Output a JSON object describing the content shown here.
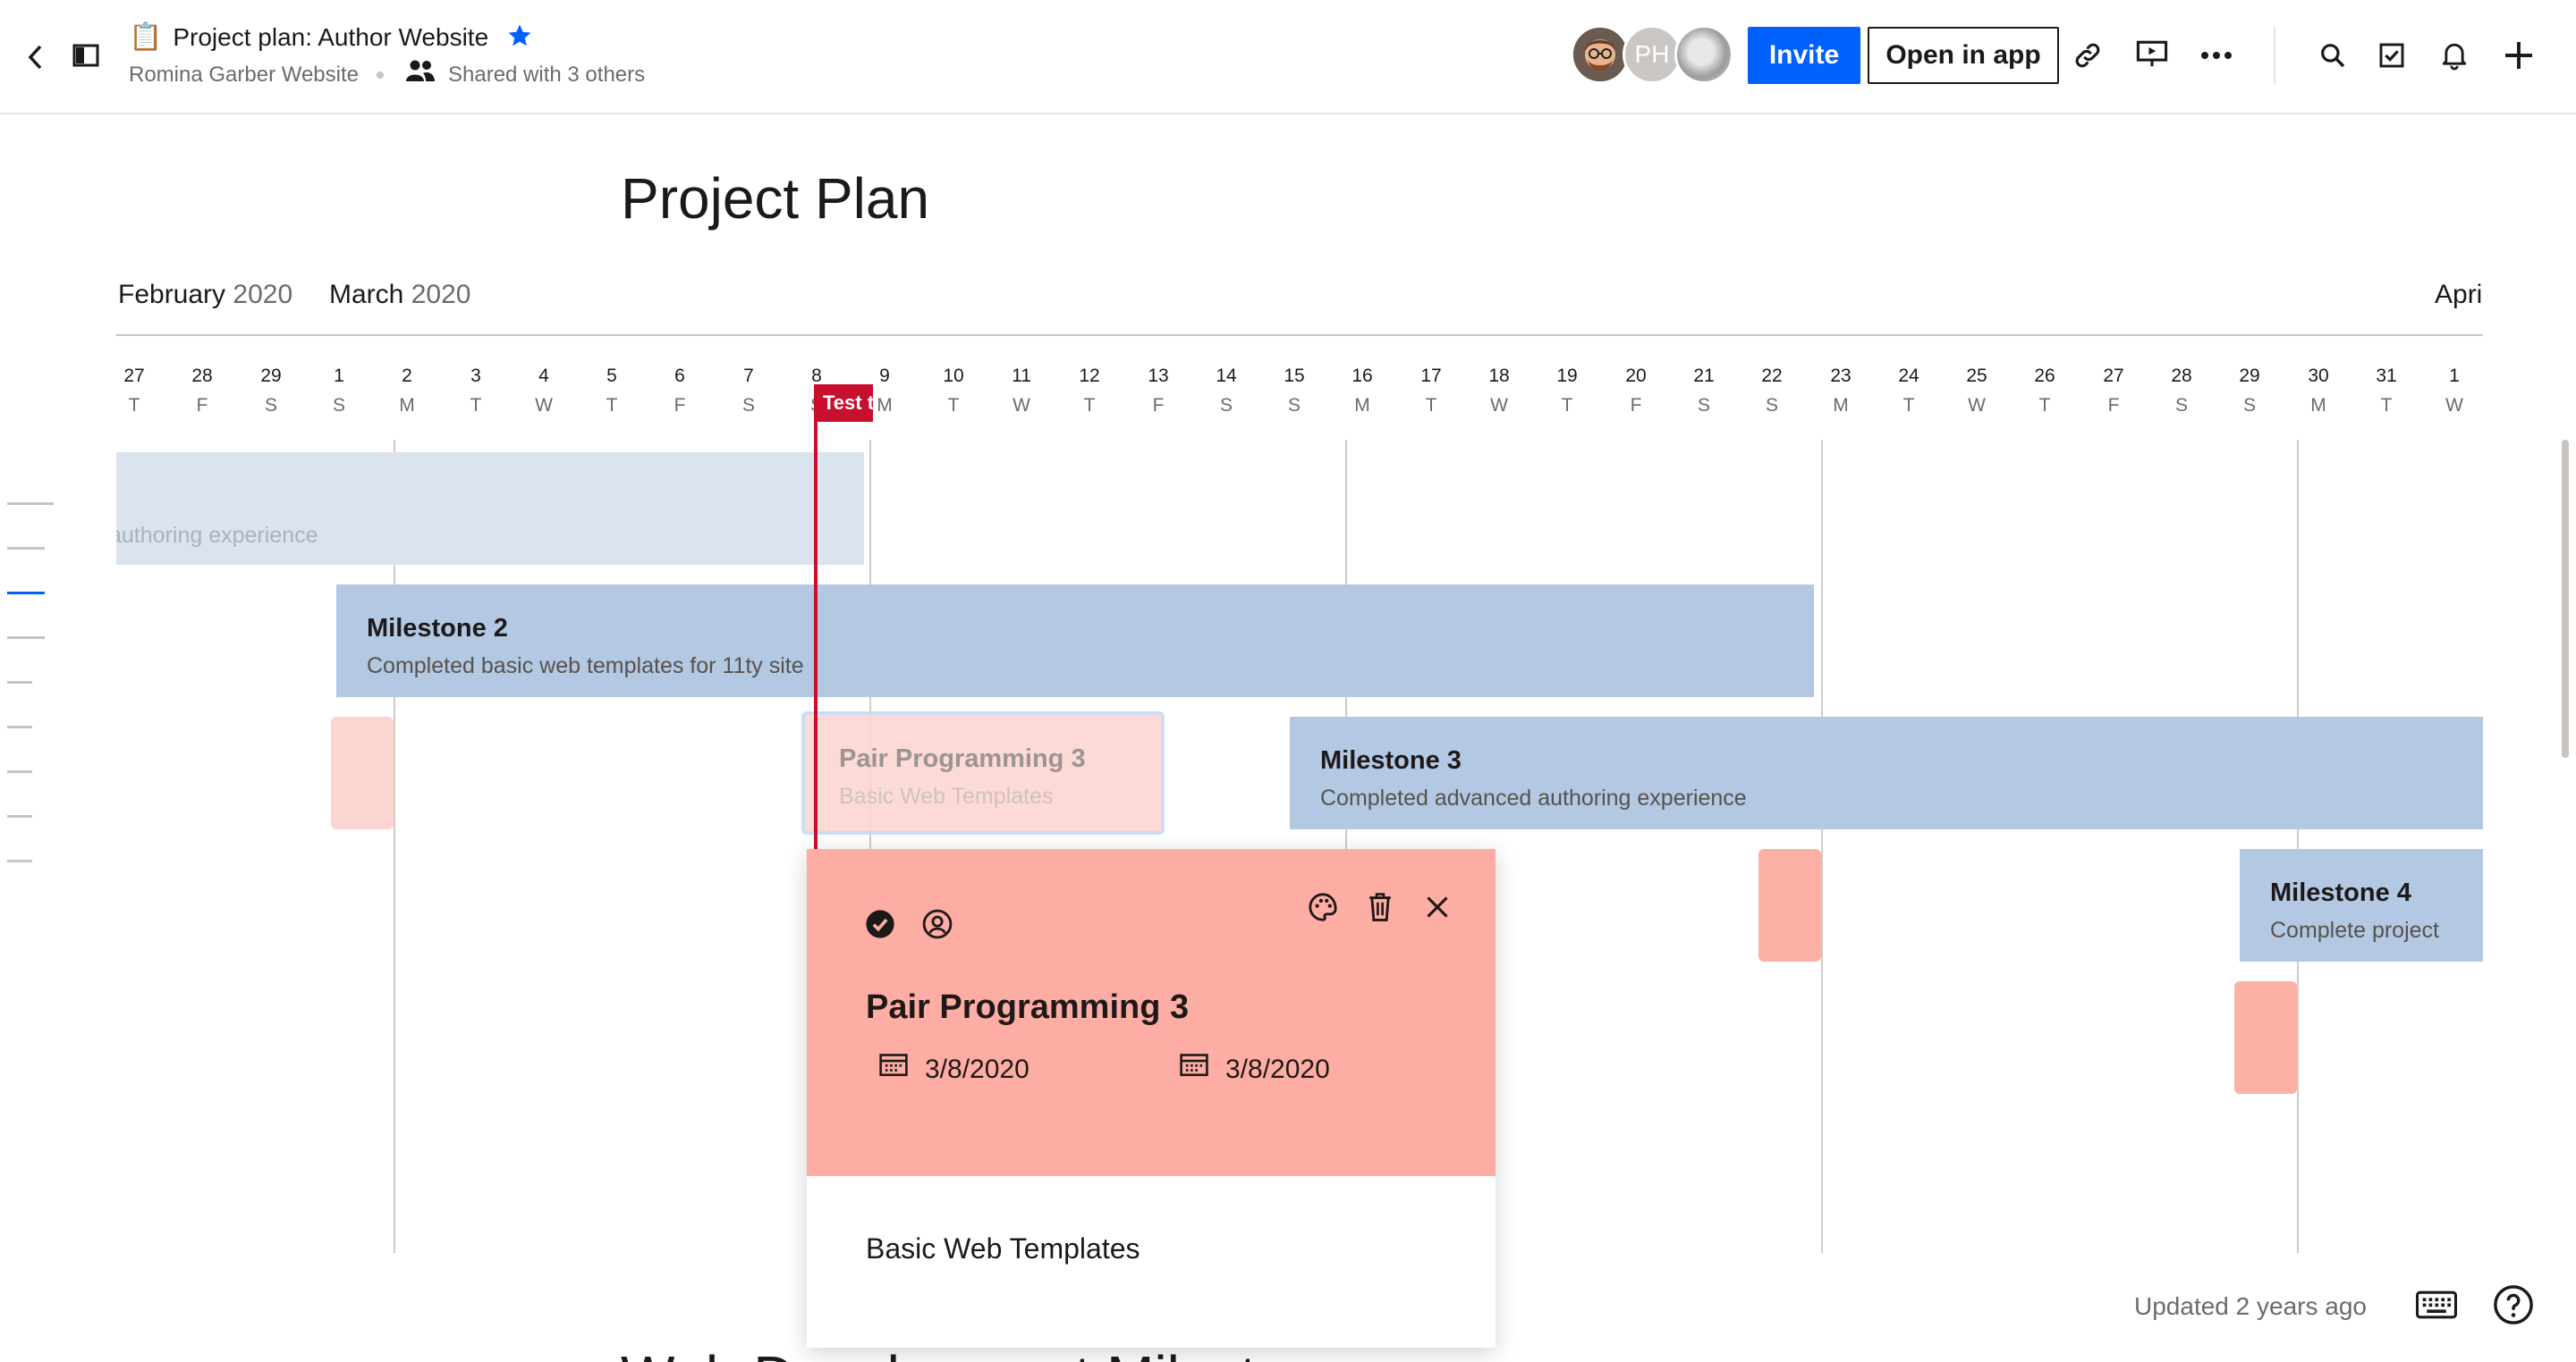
{
  "header": {
    "doc_emoji": "📋",
    "title": "Project plan: Author Website",
    "folder": "Romina Garber Website",
    "shared": "Shared with 3 others",
    "avatars": [
      {
        "name": "avatar-user-photo",
        "initials": ""
      },
      {
        "name": "avatar-ph",
        "initials": "PH"
      },
      {
        "name": "avatar-user-3",
        "initials": ""
      }
    ],
    "invite_label": "Invite",
    "open_in_app_label": "Open in app",
    "accent_color": "#0061fe"
  },
  "page": {
    "title": "Project Plan",
    "months": [
      {
        "name": "February",
        "year": "2020"
      },
      {
        "name": "March",
        "year": "2020"
      },
      {
        "name": "Apri",
        "year": ""
      }
    ],
    "days": [
      {
        "n": "27",
        "w": "T"
      },
      {
        "n": "28",
        "w": "F"
      },
      {
        "n": "29",
        "w": "S"
      },
      {
        "n": "1",
        "w": "S"
      },
      {
        "n": "2",
        "w": "M"
      },
      {
        "n": "3",
        "w": "T"
      },
      {
        "n": "4",
        "w": "W"
      },
      {
        "n": "5",
        "w": "T"
      },
      {
        "n": "6",
        "w": "F"
      },
      {
        "n": "7",
        "w": "S"
      },
      {
        "n": "8",
        "w": "S"
      },
      {
        "n": "9",
        "w": "M"
      },
      {
        "n": "10",
        "w": "T"
      },
      {
        "n": "11",
        "w": "W"
      },
      {
        "n": "12",
        "w": "T"
      },
      {
        "n": "13",
        "w": "F"
      },
      {
        "n": "14",
        "w": "S"
      },
      {
        "n": "15",
        "w": "S"
      },
      {
        "n": "16",
        "w": "M"
      },
      {
        "n": "17",
        "w": "T"
      },
      {
        "n": "18",
        "w": "W"
      },
      {
        "n": "19",
        "w": "T"
      },
      {
        "n": "20",
        "w": "F"
      },
      {
        "n": "21",
        "w": "S"
      },
      {
        "n": "22",
        "w": "S"
      },
      {
        "n": "23",
        "w": "M"
      },
      {
        "n": "24",
        "w": "T"
      },
      {
        "n": "25",
        "w": "W"
      },
      {
        "n": "26",
        "w": "T"
      },
      {
        "n": "27",
        "w": "F"
      },
      {
        "n": "28",
        "w": "S"
      },
      {
        "n": "29",
        "w": "S"
      },
      {
        "n": "30",
        "w": "M"
      },
      {
        "n": "31",
        "w": "T"
      },
      {
        "n": "1",
        "w": "W"
      }
    ],
    "today_tag": "Test t",
    "bars": {
      "m1_sub": "authoring experience",
      "m2_title": "Milestone 2",
      "m2_sub": "Completed basic web templates for 11ty site",
      "pp3_title": "Pair Programming 3",
      "pp3_sub": "Basic Web Templates",
      "m3_title": "Milestone 3",
      "m3_sub": "Completed advanced authoring experience",
      "m4_title": "Milestone 4",
      "m4_sub": "Complete project"
    },
    "colors": {
      "milestone": "#b3c8e2",
      "task": "#fdb0a6",
      "today": "#c8102e"
    }
  },
  "card": {
    "title": "Pair Programming 3",
    "start_date": "3/8/2020",
    "end_date": "3/8/2020",
    "description": "Basic Web Templates",
    "color": "#fdada3"
  },
  "footer": {
    "updated": "Updated 2 years ago",
    "next_heading": "Web Development Milest"
  }
}
